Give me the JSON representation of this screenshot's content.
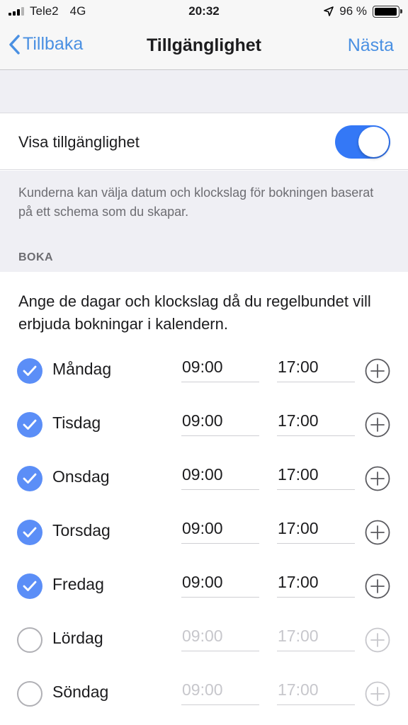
{
  "status_bar": {
    "carrier": "Tele2",
    "network": "4G",
    "time": "20:32",
    "battery": "96 %",
    "battery_level": 0.96,
    "location_icon": "location-arrow-icon"
  },
  "nav": {
    "back_label": "Tillbaka",
    "title": "Tillgänglighet",
    "next_label": "Nästa"
  },
  "availability": {
    "toggle_label": "Visa tillgänglighet",
    "toggle_on": true,
    "description": "Kunderna kan välja datum och klockslag för bokningen baserat på ett schema som du skapar."
  },
  "booking": {
    "section_title": "BOKA",
    "intro": "Ange de dagar och klockslag då du regelbundet vill erbjuda bokningar i kalendern.",
    "days": [
      {
        "name": "Måndag",
        "start": "09:00",
        "end": "17:00",
        "enabled": true
      },
      {
        "name": "Tisdag",
        "start": "09:00",
        "end": "17:00",
        "enabled": true
      },
      {
        "name": "Onsdag",
        "start": "09:00",
        "end": "17:00",
        "enabled": true
      },
      {
        "name": "Torsdag",
        "start": "09:00",
        "end": "17:00",
        "enabled": true
      },
      {
        "name": "Fredag",
        "start": "09:00",
        "end": "17:00",
        "enabled": true
      },
      {
        "name": "Lördag",
        "start": "09:00",
        "end": "17:00",
        "enabled": false
      },
      {
        "name": "Söndag",
        "start": "09:00",
        "end": "17:00",
        "enabled": false
      }
    ]
  },
  "colors": {
    "accent": "#4a90e2",
    "switch_on": "#3478f6",
    "check_on": "#5b8ef7",
    "disabled_text": "#c7c7cc",
    "background_gray": "#efeff4"
  }
}
